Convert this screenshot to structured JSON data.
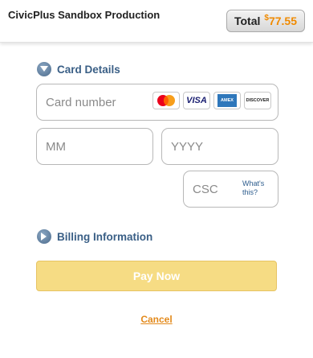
{
  "header": {
    "merchant_name": "CivicPlus Sandbox Production",
    "total_label": "Total",
    "total_currency": "$",
    "total_amount": "77.55"
  },
  "card_details": {
    "title": "Card Details",
    "card_number_placeholder": "Card number",
    "month_placeholder": "MM",
    "year_placeholder": "YYYY",
    "csc_placeholder": "CSC",
    "whats_this": "What's this?",
    "card_logos": [
      "mastercard-icon",
      "visa-icon",
      "amex-icon",
      "discover-icon"
    ],
    "visa_text": "VISA",
    "amex_text": "AMEX",
    "discover_text": "DISCOVER"
  },
  "billing": {
    "title": "Billing Information"
  },
  "actions": {
    "pay_label": "Pay Now",
    "cancel_label": "Cancel"
  },
  "colors": {
    "accent_orange": "#f08a00",
    "section_blue": "#3a5f86",
    "pay_button": "#f6dc84"
  }
}
